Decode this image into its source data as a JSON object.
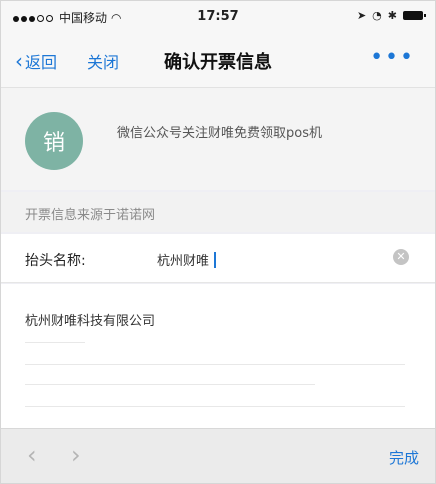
{
  "status_bar": {
    "carrier": "中国移动",
    "time": "17:57"
  },
  "nav": {
    "back_label": "返回",
    "close_label": "关闭",
    "title": "确认开票信息",
    "more_label": "•••"
  },
  "header": {
    "logo_text": "销",
    "promo_text": "微信公众号关注财唯免费领取pos机"
  },
  "source_note": "开票信息来源于诺诺网",
  "form": {
    "title_label": "抬头名称:",
    "title_value": "杭州财唯"
  },
  "suggestions": [
    "杭州财唯科技有限公司"
  ],
  "accessory": {
    "prev": "‹",
    "next": "›",
    "done_label": "完成"
  },
  "colors": {
    "accent": "#1d77d6",
    "logo_bg": "#7eb3a4"
  }
}
